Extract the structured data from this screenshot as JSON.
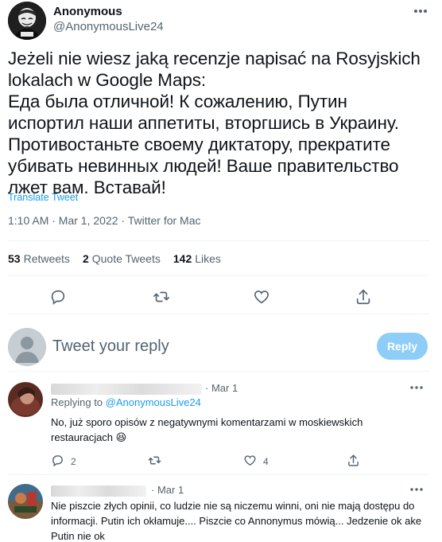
{
  "tweet": {
    "author_name": "Anonymous",
    "author_handle": "@AnonymousLive24",
    "body": "Jeżeli nie wiesz jaką recenzje napisać na Rosyjskich lokalach w Google Maps:\nЕда была отличной! К сожалению, Путин испортил наши аппетиты, вторгшись в Украину. Противостаньте своему диктатору, прекратите убивать невинных людей! Ваше правительство лжет вам. Вставай!",
    "translate_label": "Translate Tweet",
    "timestamp": "1:10 AM · Mar 1, 2022 · Twitter for Mac"
  },
  "stats": {
    "retweets_count": "53",
    "retweets_label": "Retweets",
    "quotes_count": "2",
    "quotes_label": "Quote Tweets",
    "likes_count": "142",
    "likes_label": "Likes"
  },
  "icons": {
    "more": "more-icon",
    "reply": "reply-icon",
    "retweet": "retweet-icon",
    "like": "heart-icon",
    "share": "share-icon"
  },
  "compose": {
    "placeholder": "Tweet your reply",
    "button_label": "Reply"
  },
  "replies": [
    {
      "date": "· Mar 1",
      "replying_prefix": "Replying to",
      "replying_handle": "@AnonymousLive24",
      "text": "No, już sporo opisów z negatywnymi komentarzami w moskiewskich restauracjach 😆",
      "reply_count": "2",
      "retweet_count": "",
      "like_count": "4"
    },
    {
      "date": "· Mar 1",
      "text": "Nie piszcie złych opinii, co ludzie nie są niczemu winni, oni nie mają dostępu do informacji. Putin ich okłamuje.... Piszcie co Annonymus mówią... Jedzenie ok ake Putin nie ok"
    }
  ],
  "colors": {
    "accent": "#1d9bf0",
    "reply_button": "#8ecdf8",
    "secondary_text": "#536471"
  }
}
